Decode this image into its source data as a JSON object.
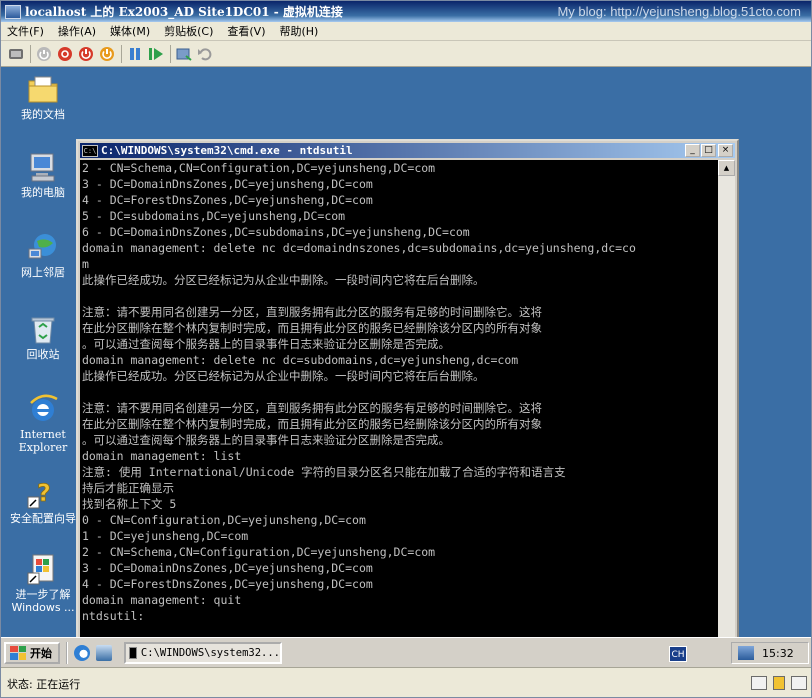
{
  "window": {
    "title": "localhost 上的 Ex2003_AD Site1DC01 - 虚拟机连接",
    "watermark": "My blog: http://yejunsheng.blog.51cto.com"
  },
  "menubar": [
    "文件(F)",
    "操作(A)",
    "媒体(M)",
    "剪贴板(C)",
    "查看(V)",
    "帮助(H)"
  ],
  "toolbar": {
    "icons": [
      "ctrl-alt-del-icon",
      "start-icon",
      "turn-off-icon",
      "shut-down-icon",
      "save-icon",
      "pause-icon",
      "resume-icon",
      "snapshot-icon",
      "revert-icon"
    ]
  },
  "desktop_icons": [
    {
      "label": "我的文档",
      "icon": "my-documents-icon"
    },
    {
      "label": "我的电脑",
      "icon": "my-computer-icon"
    },
    {
      "label": "网上邻居",
      "icon": "network-places-icon"
    },
    {
      "label": "回收站",
      "icon": "recycle-bin-icon"
    },
    {
      "label": "Internet Explorer",
      "icon": "internet-explorer-icon"
    },
    {
      "label": "安全配置向导",
      "icon": "security-wizard-icon"
    },
    {
      "label": "进一步了解 Windows ...",
      "icon": "learn-windows-icon"
    }
  ],
  "cmd": {
    "title": "C:\\WINDOWS\\system32\\cmd.exe - ntdsutil",
    "lines": [
      "2 - CN=Schema,CN=Configuration,DC=yejunsheng,DC=com",
      "3 - DC=DomainDnsZones,DC=yejunsheng,DC=com",
      "4 - DC=ForestDnsZones,DC=yejunsheng,DC=com",
      "5 - DC=subdomains,DC=yejunsheng,DC=com",
      "6 - DC=DomainDnsZones,DC=subdomains,DC=yejunsheng,DC=com",
      "domain management: delete nc dc=domaindnszones,dc=subdomains,dc=yejunsheng,dc=co",
      "m",
      "此操作已经成功。分区已经标记为从企业中删除。一段时间内它将在后台删除。",
      "",
      "注意：请不要用同名创建另一分区，直到服务拥有此分区的服务有足够的时间删除它。这将",
      "在此分区删除在整个林内复制时完成，而且拥有此分区的服务已经删除该分区内的所有对象",
      "。可以通过查阅每个服务器上的目录事件日志来验证分区删除是否完成。",
      "domain management: delete nc dc=subdomains,dc=yejunsheng,dc=com",
      "此操作已经成功。分区已经标记为从企业中删除。一段时间内它将在后台删除。",
      "",
      "注意：请不要用同名创建另一分区，直到服务拥有此分区的服务有足够的时间删除它。这将",
      "在此分区删除在整个林内复制时完成，而且拥有此分区的服务已经删除该分区内的所有对象",
      "。可以通过查阅每个服务器上的目录事件日志来验证分区删除是否完成。",
      "domain management: list",
      "注意: 使用 International/Unicode 字符的目录分区名只能在加载了合适的字符和语言支",
      "持后才能正确显示",
      "找到名称上下文 5",
      "0 - CN=Configuration,DC=yejunsheng,DC=com",
      "1 - DC=yejunsheng,DC=com",
      "2 - CN=Schema,CN=Configuration,DC=yejunsheng,DC=com",
      "3 - DC=DomainDnsZones,DC=yejunsheng,DC=com",
      "4 - DC=ForestDnsZones,DC=yejunsheng,DC=com",
      "domain management: quit",
      "ntdsutil:"
    ]
  },
  "taskbar": {
    "start_label": "开始",
    "task_label": "C:\\WINDOWS\\system32...",
    "ime_label": "CH",
    "clock": "15:32"
  },
  "status": {
    "text": "状态: 正在运行"
  }
}
